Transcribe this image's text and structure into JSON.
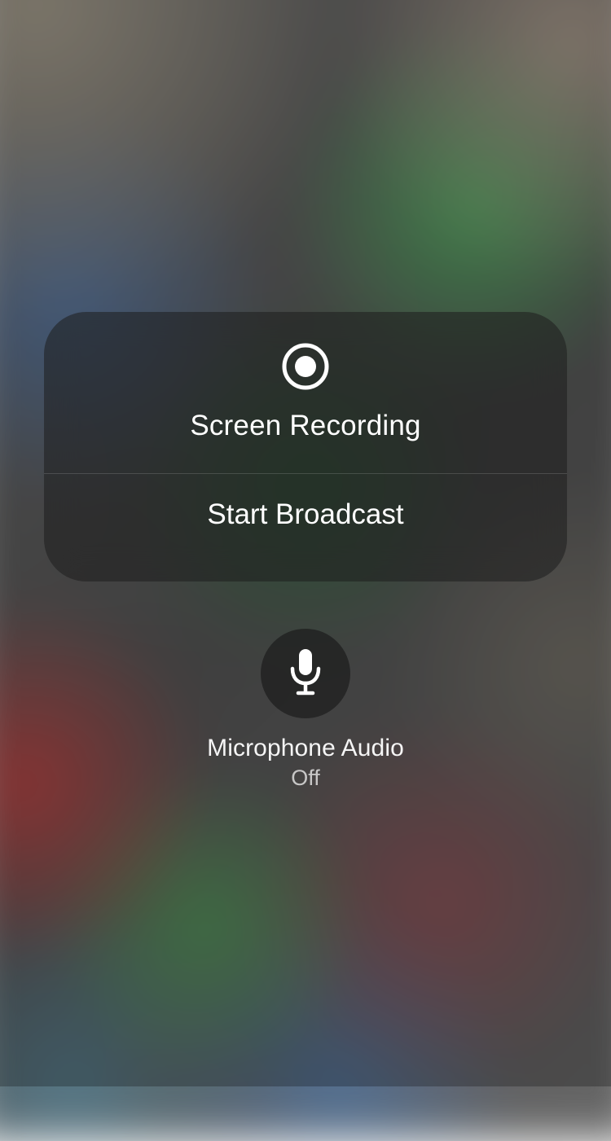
{
  "panel": {
    "title": "Screen Recording",
    "action": "Start Broadcast"
  },
  "microphone": {
    "label": "Microphone Audio",
    "status": "Off"
  }
}
